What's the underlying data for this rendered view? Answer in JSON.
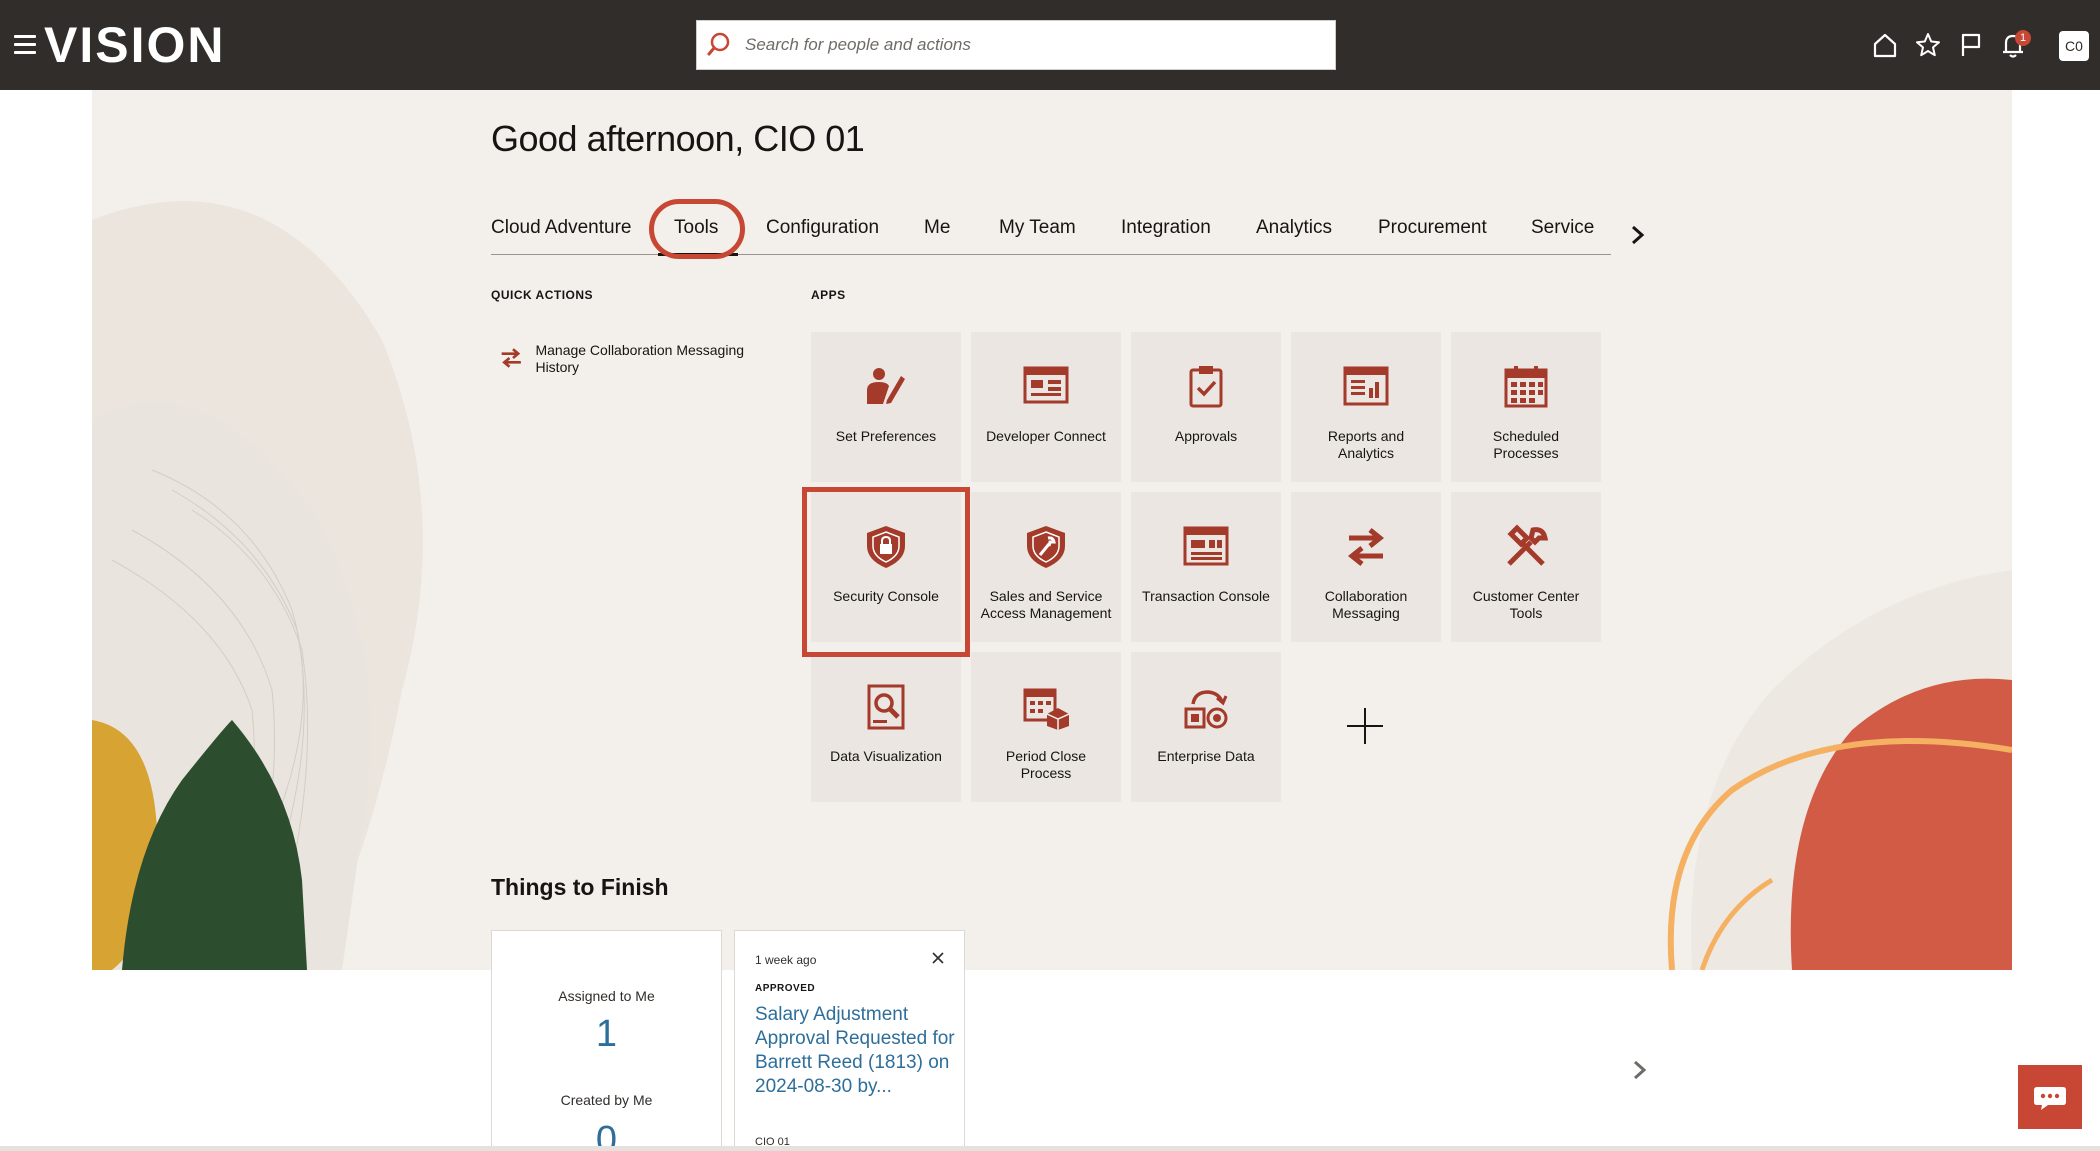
{
  "header": {
    "logo": "VISION",
    "search_placeholder": "Search for people and actions",
    "notifications_count": "1",
    "avatar_initials": "C0"
  },
  "greeting": "Good afternoon, CIO 01",
  "tabs": [
    {
      "label": "Cloud Adventure"
    },
    {
      "label": "Tools",
      "active": true
    },
    {
      "label": "Configuration"
    },
    {
      "label": "Me"
    },
    {
      "label": "My Team"
    },
    {
      "label": "Integration"
    },
    {
      "label": "Analytics"
    },
    {
      "label": "Procurement"
    },
    {
      "label": "Service"
    }
  ],
  "quick_actions": {
    "heading": "QUICK ACTIONS",
    "items": [
      {
        "label": "Manage Collaboration Messaging History",
        "icon": "swap-arrows-icon"
      }
    ]
  },
  "apps": {
    "heading": "APPS",
    "tiles": [
      {
        "label": "Set Preferences",
        "icon": "set-preferences-icon"
      },
      {
        "label": "Developer Connect",
        "icon": "developer-connect-icon"
      },
      {
        "label": "Approvals",
        "icon": "clipboard-check-icon"
      },
      {
        "label": "Reports and Analytics",
        "icon": "reports-icon"
      },
      {
        "label": "Scheduled Processes",
        "icon": "calendar-icon"
      },
      {
        "label": "Security Console",
        "icon": "shield-lock-icon"
      },
      {
        "label": "Sales and Service Access Management",
        "icon": "shield-wrench-icon"
      },
      {
        "label": "Transaction Console",
        "icon": "transaction-console-icon"
      },
      {
        "label": "Collaboration Messaging",
        "icon": "swap-arrows-icon"
      },
      {
        "label": "Customer Center Tools",
        "icon": "tools-icon"
      },
      {
        "label": "Data Visualization",
        "icon": "data-visualization-icon"
      },
      {
        "label": "Period Close Process",
        "icon": "period-close-icon"
      },
      {
        "label": "Enterprise Data",
        "icon": "enterprise-data-icon"
      }
    ]
  },
  "things_to_finish": {
    "heading": "Things to Finish",
    "summary": {
      "assigned_label": "Assigned to Me",
      "assigned_count": "1",
      "created_label": "Created by Me",
      "created_count": "0"
    },
    "cards": [
      {
        "time": "1 week ago",
        "status": "APPROVED",
        "title": "Salary Adjustment Approval Requested for Barrett Reed (1813) on 2024-08-30 by...",
        "owner": "CIO 01"
      }
    ]
  },
  "colors": {
    "header_bg": "#312d2a",
    "accent": "#c74634",
    "icon": "#a33a2a",
    "link": "#2e6e9a",
    "panel_bg": "#f3efeb"
  }
}
